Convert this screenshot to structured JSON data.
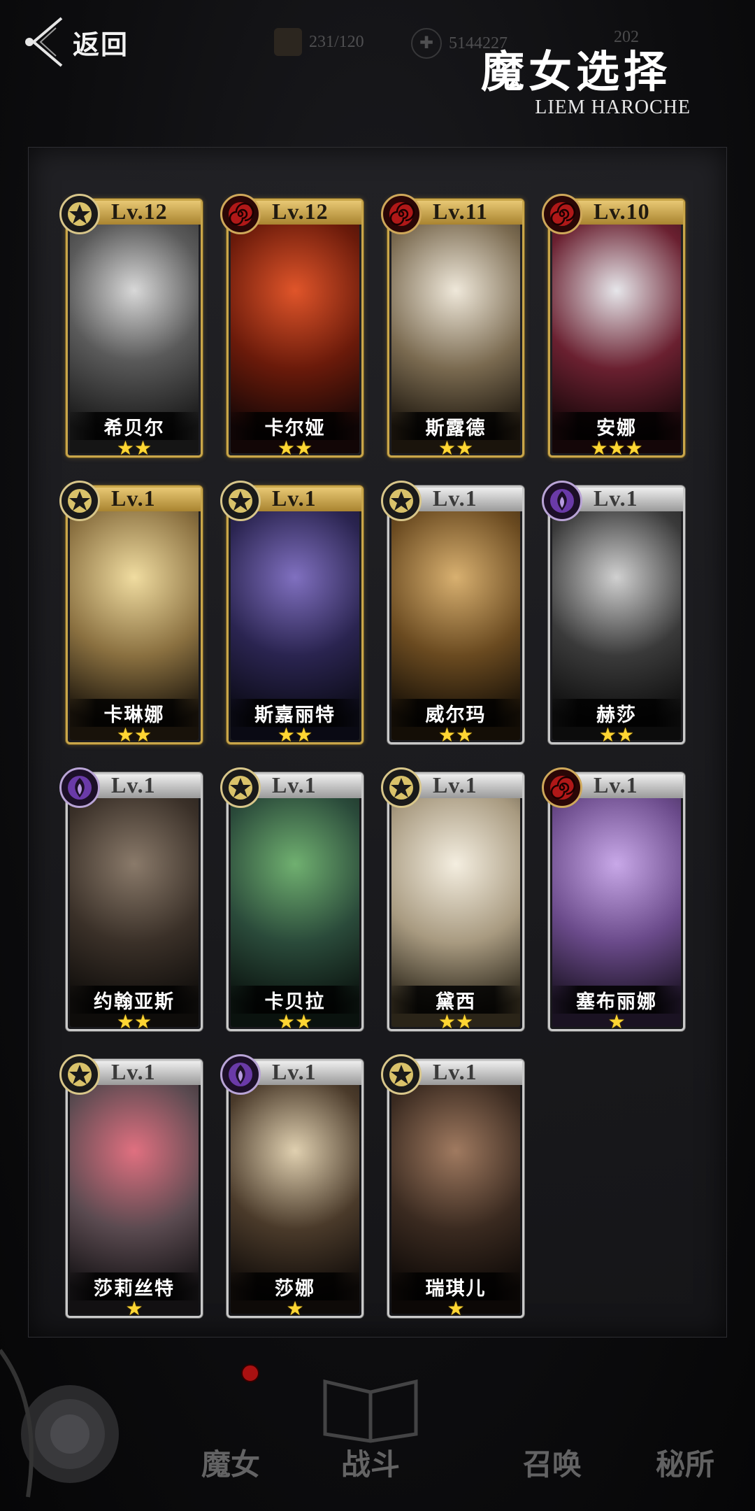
{
  "header": {
    "back_label": "返回",
    "resource_1": "231/120",
    "resource_2": "5144227",
    "resource_3": "202",
    "title": "魔女选择",
    "subtitle": "LIEM HAROCHE"
  },
  "cards": [
    {
      "level": "Lv.12",
      "name": "希贝尔",
      "stars": "★★",
      "badge": "star",
      "frame": "gold"
    },
    {
      "level": "Lv.12",
      "name": "卡尔娅",
      "stars": "★★",
      "badge": "spiral",
      "frame": "gold"
    },
    {
      "level": "Lv.11",
      "name": "斯露德",
      "stars": "★★",
      "badge": "spiral",
      "frame": "gold"
    },
    {
      "level": "Lv.10",
      "name": "安娜",
      "stars": "★★★",
      "badge": "spiral",
      "frame": "gold"
    },
    {
      "level": "Lv.1",
      "name": "卡琳娜",
      "stars": "★★",
      "badge": "star",
      "frame": "gold"
    },
    {
      "level": "Lv.1",
      "name": "斯嘉丽特",
      "stars": "★★",
      "badge": "star",
      "frame": "gold"
    },
    {
      "level": "Lv.1",
      "name": "威尔玛",
      "stars": "★★",
      "badge": "star",
      "frame": "silver"
    },
    {
      "level": "Lv.1",
      "name": "赫莎",
      "stars": "★★",
      "badge": "flame",
      "frame": "silver"
    },
    {
      "level": "Lv.1",
      "name": "约翰亚斯",
      "stars": "★★",
      "badge": "flame",
      "frame": "silver"
    },
    {
      "level": "Lv.1",
      "name": "卡贝拉",
      "stars": "★★",
      "badge": "star",
      "frame": "silver"
    },
    {
      "level": "Lv.1",
      "name": "黛西",
      "stars": "★★",
      "badge": "star",
      "frame": "silver"
    },
    {
      "level": "Lv.1",
      "name": "塞布丽娜",
      "stars": "★",
      "badge": "spiral",
      "frame": "silver"
    },
    {
      "level": "Lv.1",
      "name": "莎莉丝特",
      "stars": "★",
      "badge": "star",
      "frame": "silver"
    },
    {
      "level": "Lv.1",
      "name": "莎娜",
      "stars": "★",
      "badge": "flame",
      "frame": "silver"
    },
    {
      "level": "Lv.1",
      "name": "瑞琪儿",
      "stars": "★",
      "badge": "star",
      "frame": "silver"
    }
  ],
  "nav": [
    {
      "label": "魔女"
    },
    {
      "label": "战斗"
    },
    {
      "label": "召唤"
    },
    {
      "label": "秘所"
    }
  ],
  "colors": {
    "gold_frame": "#c9a64a",
    "silver_frame": "#c9c9c9",
    "star": "#ffd633",
    "background": "#0b0b0d"
  }
}
